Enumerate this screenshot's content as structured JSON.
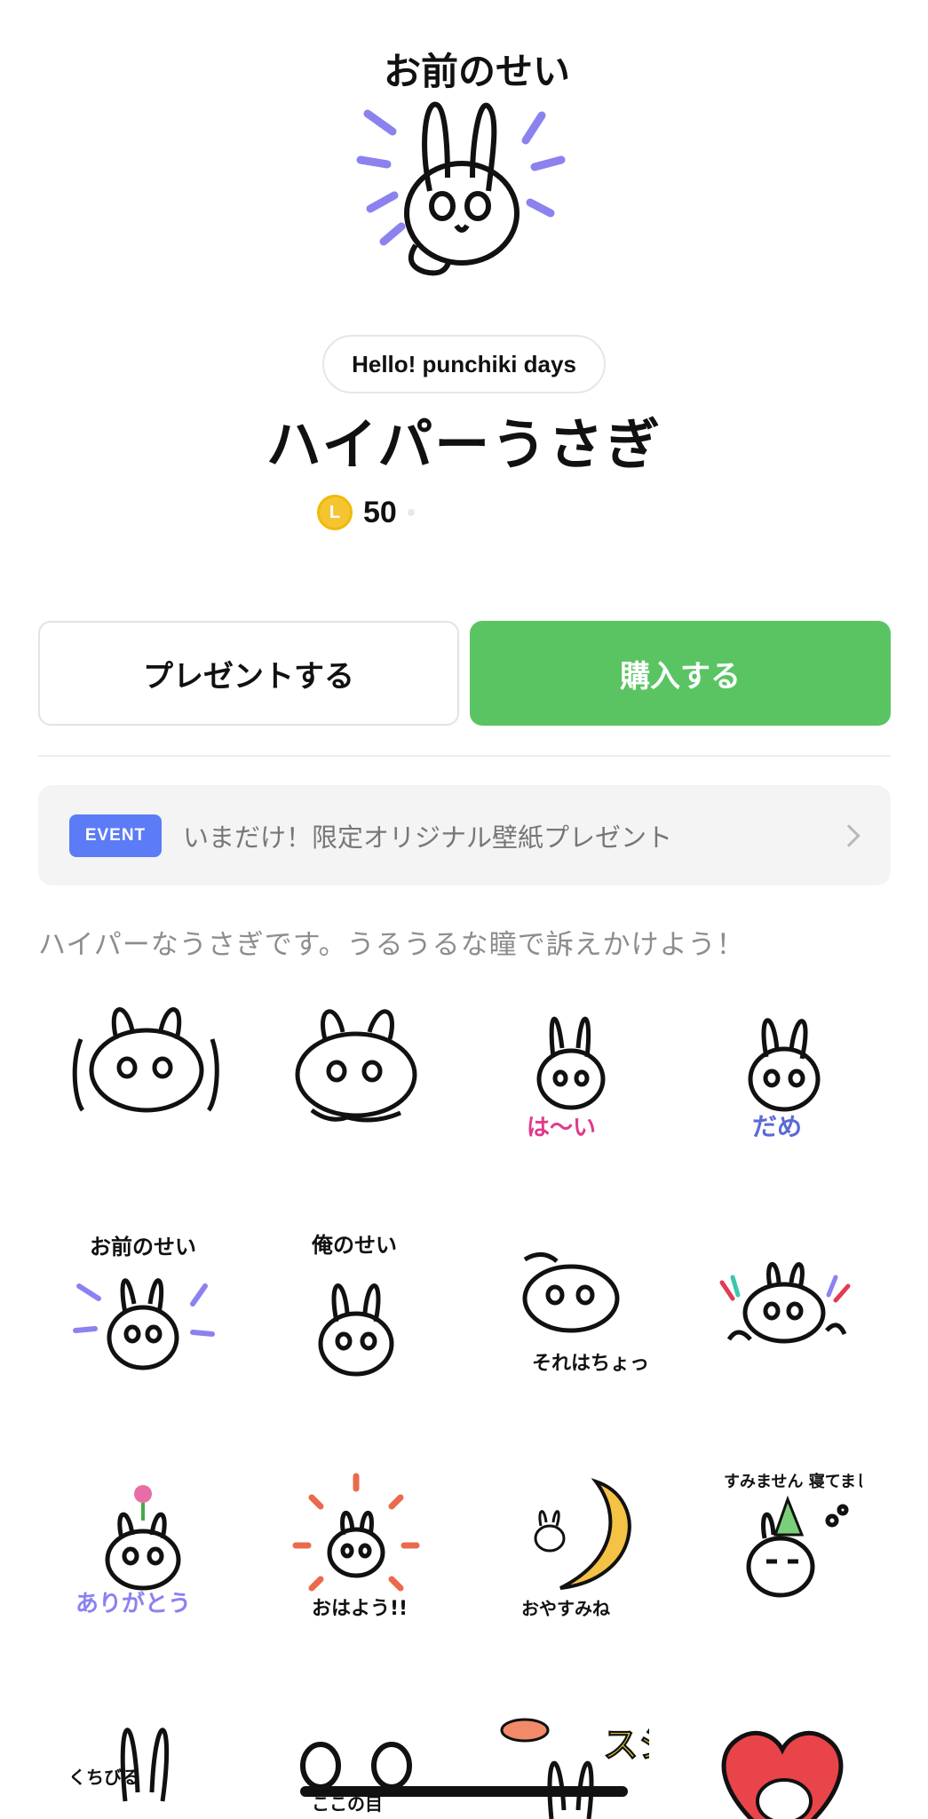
{
  "hero": {
    "caption": "お前のせい"
  },
  "author": "Hello! punchiki days",
  "title": "ハイパーうさぎ",
  "price": {
    "coin_letter": "L",
    "amount": "50"
  },
  "buttons": {
    "present": "プレゼントする",
    "buy": "購入する"
  },
  "event": {
    "badge": "EVENT",
    "text": "いまだけ！限定オリジナル壁紙プレゼント"
  },
  "description": "ハイパーなうさぎです。うるうるな瞳で訴えかけよう！",
  "stickers": [
    {
      "caption": ""
    },
    {
      "caption": ""
    },
    {
      "caption": "は～い"
    },
    {
      "caption": "だめ"
    },
    {
      "caption": "お前のせい"
    },
    {
      "caption": "俺のせい"
    },
    {
      "caption": "それはちょっと"
    },
    {
      "caption": ""
    },
    {
      "caption": "ありがとう"
    },
    {
      "caption": "おはよう!!"
    },
    {
      "caption": "おやすみね"
    },
    {
      "caption": "すみません 寝てました"
    },
    {
      "caption": "くちびる"
    },
    {
      "caption": "ここの目"
    },
    {
      "caption": "スシ"
    },
    {
      "caption": ""
    }
  ],
  "colors": {
    "buy": "#5ac463",
    "event_badge": "#5b7cf6",
    "coin": "#f5c531",
    "accent_purple": "#8b82f0"
  }
}
